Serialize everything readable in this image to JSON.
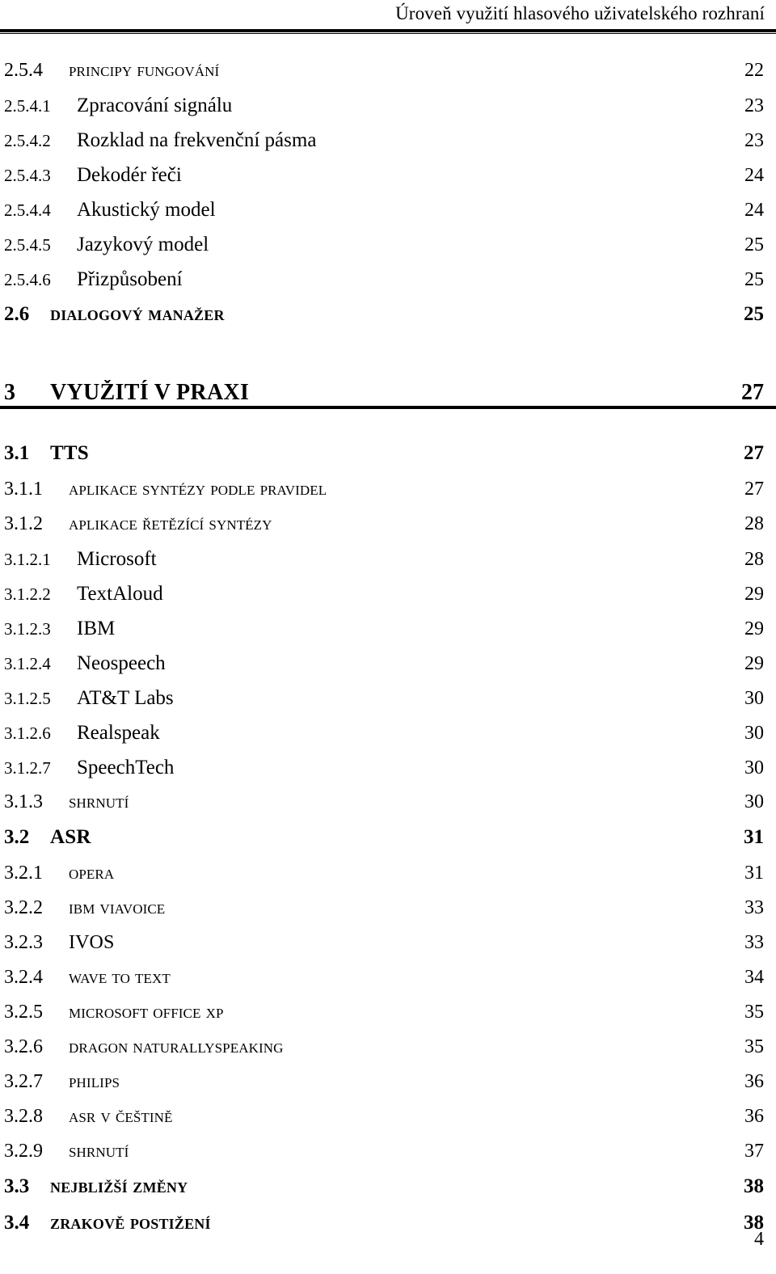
{
  "header": {
    "running_title": "Úroveň využití hlasového uživatelského rozhraní"
  },
  "footer": {
    "page_number": "4"
  },
  "toc": {
    "entries": [
      {
        "level": 3,
        "number": "2.5.4",
        "label": "Principy fungování",
        "page": "22",
        "smallcaps": true
      },
      {
        "level": 4,
        "number": "2.5.4.1",
        "label": "Zpracování signálu",
        "page": "23",
        "smallcaps": false
      },
      {
        "level": 4,
        "number": "2.5.4.2",
        "label": "Rozklad na frekvenční pásma",
        "page": "23",
        "smallcaps": false
      },
      {
        "level": 4,
        "number": "2.5.4.3",
        "label": "Dekodér řeči",
        "page": "24",
        "smallcaps": false
      },
      {
        "level": 4,
        "number": "2.5.4.4",
        "label": "Akustický model",
        "page": "24",
        "smallcaps": false
      },
      {
        "level": 4,
        "number": "2.5.4.5",
        "label": "Jazykový model",
        "page": "25",
        "smallcaps": false
      },
      {
        "level": 4,
        "number": "2.5.4.6",
        "label": "Přizpůsobení",
        "page": "25",
        "smallcaps": false
      },
      {
        "level": 2,
        "number": "2.6",
        "label": "Dialogový manažer",
        "page": "25",
        "smallcaps": true
      },
      {
        "level": 1,
        "number": "3",
        "label": "VYUŽITÍ V PRAXI",
        "page": "27",
        "smallcaps": false
      },
      {
        "level": 2,
        "number": "3.1",
        "label": "TTS",
        "page": "27",
        "smallcaps": false
      },
      {
        "level": 3,
        "number": "3.1.1",
        "label": "Aplikace syntézy podle pravidel",
        "page": "27",
        "smallcaps": true
      },
      {
        "level": 3,
        "number": "3.1.2",
        "label": "Aplikace řetězící syntézy",
        "page": "28",
        "smallcaps": true
      },
      {
        "level": 4,
        "number": "3.1.2.1",
        "label": "Microsoft",
        "page": "28",
        "smallcaps": false
      },
      {
        "level": 4,
        "number": "3.1.2.2",
        "label": "TextAloud",
        "page": "29",
        "smallcaps": false
      },
      {
        "level": 4,
        "number": "3.1.2.3",
        "label": "IBM",
        "page": "29",
        "smallcaps": false
      },
      {
        "level": 4,
        "number": "3.1.2.4",
        "label": "Neospeech",
        "page": "29",
        "smallcaps": false
      },
      {
        "level": 4,
        "number": "3.1.2.5",
        "label": "AT&T Labs",
        "page": "30",
        "smallcaps": false
      },
      {
        "level": 4,
        "number": "3.1.2.6",
        "label": "Realspeak",
        "page": "30",
        "smallcaps": false
      },
      {
        "level": 4,
        "number": "3.1.2.7",
        "label": "SpeechTech",
        "page": "30",
        "smallcaps": false
      },
      {
        "level": 3,
        "number": "3.1.3",
        "label": "Shrnutí",
        "page": "30",
        "smallcaps": true
      },
      {
        "level": 2,
        "number": "3.2",
        "label": "ASR",
        "page": "31",
        "smallcaps": false
      },
      {
        "level": 3,
        "number": "3.2.1",
        "label": "Opera",
        "page": "31",
        "smallcaps": true
      },
      {
        "level": 3,
        "number": "3.2.2",
        "label": "IBM ViaVoice",
        "page": "33",
        "smallcaps": true
      },
      {
        "level": 3,
        "number": "3.2.3",
        "label": "IVOS",
        "page": "33",
        "smallcaps": false
      },
      {
        "level": 3,
        "number": "3.2.4",
        "label": "Wave To Text",
        "page": "34",
        "smallcaps": true
      },
      {
        "level": 3,
        "number": "3.2.5",
        "label": "Microsoft Office XP",
        "page": "35",
        "smallcaps": true
      },
      {
        "level": 3,
        "number": "3.2.6",
        "label": "Dragon NaturallySpeaking",
        "page": "35",
        "smallcaps": true
      },
      {
        "level": 3,
        "number": "3.2.7",
        "label": "Philips",
        "page": "36",
        "smallcaps": true
      },
      {
        "level": 3,
        "number": "3.2.8",
        "label": "ASR v češtině",
        "page": "36",
        "smallcaps": true
      },
      {
        "level": 3,
        "number": "3.2.9",
        "label": "Shrnutí",
        "page": "37",
        "smallcaps": true
      },
      {
        "level": 2,
        "number": "3.3",
        "label": "Nejbližší změny",
        "page": "38",
        "smallcaps": true
      },
      {
        "level": 2,
        "number": "3.4",
        "label": "Zrakově postižení",
        "page": "38",
        "smallcaps": true
      }
    ]
  }
}
